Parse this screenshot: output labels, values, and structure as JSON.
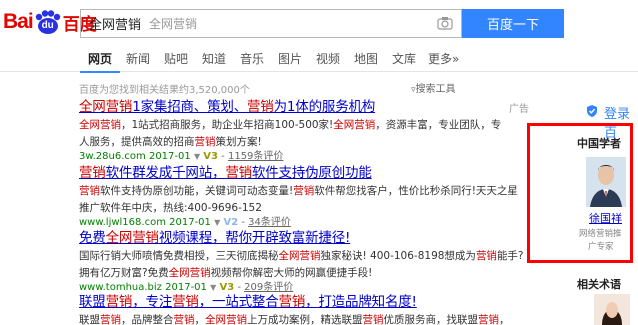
{
  "logo": {
    "left": "Bai",
    "paw": "du",
    "brand": "百度"
  },
  "search": {
    "query": "全网营销",
    "suggest": "全网营销",
    "button": "百度一下"
  },
  "tabs": [
    "网页",
    "新闻",
    "贴吧",
    "知道",
    "音乐",
    "图片",
    "视频",
    "地图",
    "文库",
    "更多»"
  ],
  "result_count": "百度为您找到相关结果约3,520,000个",
  "search_tools": "搜索工具",
  "ad_label": "广告",
  "results": [
    {
      "title_html": "<em>全网营销</em>1家集招商、策划、<em>营销</em>为1体的服务机构",
      "desc_lines": [
        "<em>全网营销</em>，1站式招商服务，助企业年招商100-500家!<em>全网营销</em>，资源丰富，专业团队，专",
        "人服务，提供高效的招商<em>营销</em>策划方案!"
      ],
      "url": "3w.28u6.com",
      "date": "2017-01",
      "v": "V3",
      "eval": "1159条评价"
    },
    {
      "title_html": "<em>营销</em>软件群发成千网站，<em>营销</em>软件支持伪原创功能",
      "desc_lines": [
        "<em>营销</em>软件支持伪原创功能，关键词可动态变量!<em>营销</em>软件帮您找客户，性价比秒杀同行!天天之星",
        "推广软件年中庆，热线:400-9696-152"
      ],
      "url": "www.ljwl168.com",
      "date": "2017-01",
      "v": "V2",
      "eval": "34条评价"
    },
    {
      "title_html": "免费<em>全网营销</em>视频课程，帮你开辟致富新捷径!",
      "desc_lines": [
        "国际行销大师喷情免费相授，三天彻底揭秘<em>全网营销</em>独家秘诀! 400-106-8198想成为<em>营销</em>能手?",
        "拥有亿万财富?免费<em>全网营销</em>视频帮你解密大师的网赢便捷手段!"
      ],
      "url": "www.tomhua.biz",
      "date": "2017-01",
      "v": "V3",
      "eval": "209条评价"
    },
    {
      "title_html": "联盟<em>营销</em>，专注<em>营销</em>，一站式整合<em>营销</em>，打造品牌知名度!",
      "desc_lines": [
        "联盟<em>营销</em>，品牌整合<em>营销</em>，<em>全网营销</em>上万成功案例，精选联盟<em>营销</em>优质服务商，找联盟<em>营销</em>，"
      ],
      "url": "",
      "date": "",
      "v": "",
      "eval": ""
    }
  ],
  "right": {
    "login": "登录百",
    "expert_title": "中国学者",
    "expert_name": "徐国祥",
    "expert_role": "网络营销推",
    "expert_badge": "广专家",
    "related_title": "相关术语"
  },
  "colors": {
    "brand_red": "#e10601",
    "brand_blue": "#2932e1",
    "search_blue": "#3385ff",
    "link": "#0000cc",
    "highlight": "#cc0000",
    "url_green": "#008000",
    "box_red": "#ff0000"
  }
}
